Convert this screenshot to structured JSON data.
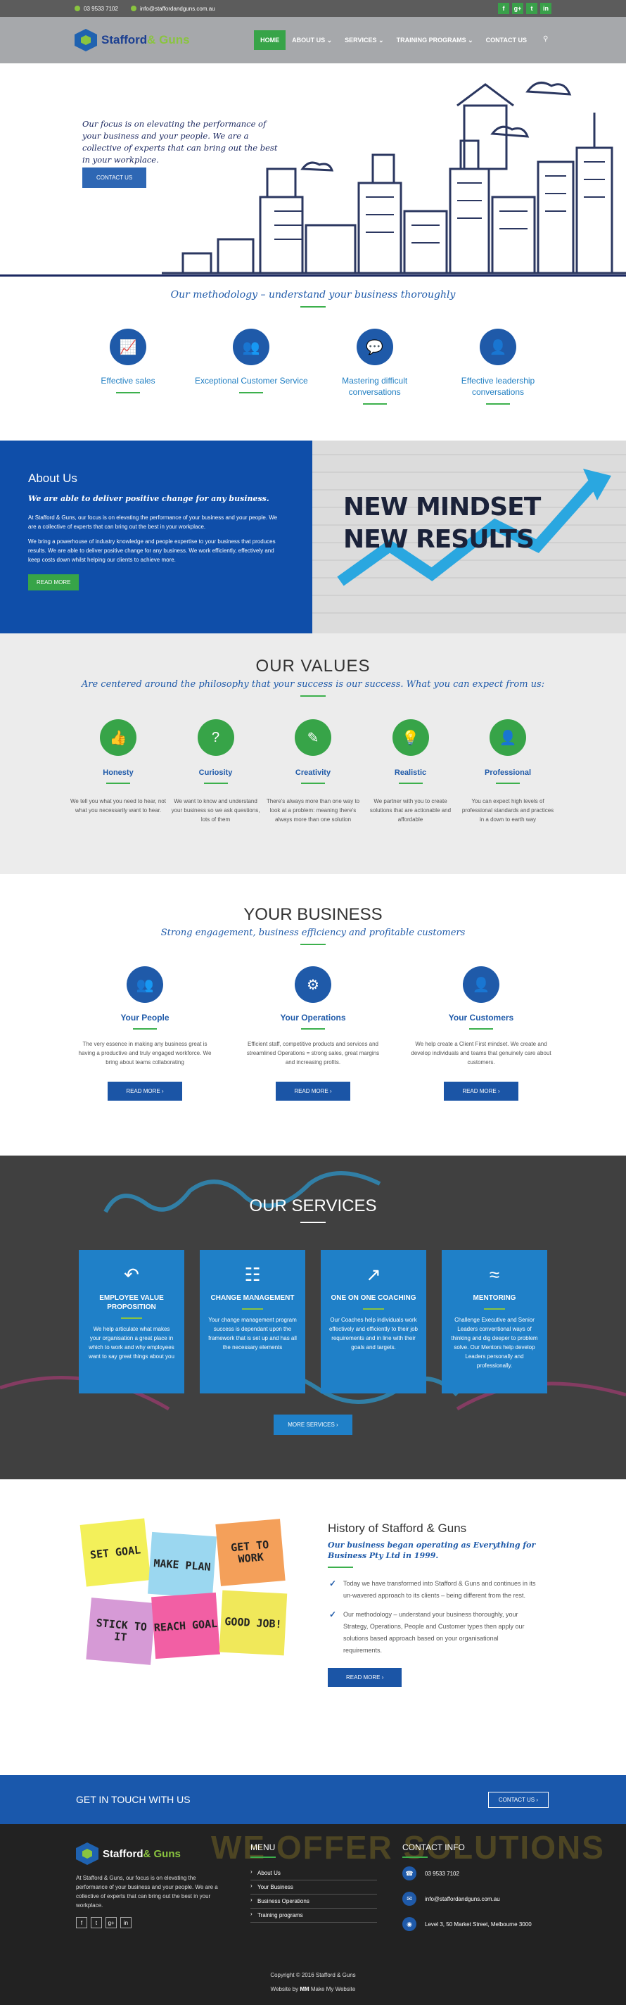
{
  "topbar": {
    "phone": "03 9533 7102",
    "email": "info@staffordandguns.com.au",
    "social": [
      "f",
      "g+",
      "t",
      "in"
    ]
  },
  "logo": {
    "name_a": "Stafford",
    "name_b": "& Guns"
  },
  "nav": {
    "items": [
      "HOME",
      "ABOUT US",
      "SERVICES",
      "TRAINING PROGRAMS",
      "CONTACT US"
    ]
  },
  "hero": {
    "text": "Our focus is on elevating the performance of your business and your people. We are a collective of experts that can bring out the best in your workplace.",
    "button": "CONTACT US"
  },
  "method": {
    "title": "Our methodology – understand your business thoroughly",
    "items": [
      "Effective sales",
      "Exceptional Customer Service",
      "Mastering difficult conversations",
      "Effective leadership conversations"
    ]
  },
  "about": {
    "title": "About Us",
    "subtitle": "We are able to deliver positive change for any business.",
    "p1": "At Stafford & Guns, our focus is on elevating the performance of your business and your people. We are a collective of experts that can bring out the best in your workplace.",
    "p2": "We bring a powerhouse of industry knowledge and people expertise to your business that produces results. We are able to deliver positive change for any business. We work efficiently, effectively and keep costs down whilst helping our clients to achieve more.",
    "button": "READ MORE",
    "img_line1": "NEW MINDSET",
    "img_line2": "NEW RESULTS"
  },
  "values": {
    "title": "OUR VALUES",
    "subtitle": "Are centered around the philosophy that your success is our success. What you can expect from us:",
    "items": [
      {
        "name": "Honesty",
        "text": "We tell you what you need to hear, not what you necessarily want to hear.",
        "icon": "thumbs-up"
      },
      {
        "name": "Curiosity",
        "text": "We want to know and understand your business so we ask questions, lots of them",
        "icon": "question"
      },
      {
        "name": "Creativity",
        "text": "There's always more than one way to look at a problem: meaning there's always more than one solution",
        "icon": "pencil"
      },
      {
        "name": "Realistic",
        "text": "We partner with you to create solutions that are actionable and affordable",
        "icon": "lightbulb"
      },
      {
        "name": "Professional",
        "text": "You can expect high levels of professional standards and practices in a down to earth way",
        "icon": "user"
      }
    ]
  },
  "business": {
    "title": "YOUR BUSINESS",
    "subtitle": "Strong engagement, business efficiency and profitable customers",
    "items": [
      {
        "name": "Your People",
        "text": "The very essence in making any business great is having a productive and truly engaged workforce. We bring about teams collaborating",
        "button": "READ MORE"
      },
      {
        "name": "Your Operations",
        "text": "Efficient staff, competitive products and services and streamlined Operations = strong sales, great margins and increasing profits.",
        "button": "READ MORE"
      },
      {
        "name": "Your Customers",
        "text": "We help create a Client First mindset. We create and develop individuals and teams that genuinely care about customers.",
        "button": "READ MORE"
      }
    ]
  },
  "services": {
    "title": "OUR SERVICES",
    "button": "MORE SERVICES",
    "items": [
      {
        "name": "EMPLOYEE VALUE PROPOSITION",
        "text": "We help articulate what makes your organisation a great place in which to work and why employees want to say great things about you"
      },
      {
        "name": "CHANGE MANAGEMENT",
        "text": "Your change management program success is dependant upon the framework that is set up and has all the necessary elements"
      },
      {
        "name": "ONE ON ONE COACHING",
        "text": "Our Coaches help individuals work effectively and efficiently to their job requirements and in line with their goals and targets."
      },
      {
        "name": "MENTORING",
        "text": "Challenge Executive and Senior Leaders conventional ways of thinking and dig deeper to problem solve. Our Mentors help develop Leaders personally and professionally."
      }
    ]
  },
  "history": {
    "title": "History of Stafford & Guns",
    "subtitle": "Our business began operating as Everything for Business Pty Ltd in 1999.",
    "points": [
      "Today we have transformed into Stafford & Guns and continues in its un-wavered approach to its clients – being different from the rest.",
      "Our methodology – understand your business thoroughly, your Strategy, Operations, People and Customer types then apply our solutions based approach based on your organisational requirements."
    ],
    "button": "READ MORE",
    "notes": [
      "SET GOAL",
      "MAKE PLAN",
      "GET TO WORK",
      "STICK TO IT",
      "REACH GOAL",
      "GOOD JOB!"
    ]
  },
  "touch": {
    "title": "GET IN TOUCH WITH US",
    "button": "CONTACT US"
  },
  "footer": {
    "watermark": "WE OFFER SOLUTIONS",
    "about": "At Stafford & Guns, our focus is on elevating the performance of your business and your people. We are a collective of experts that can bring out the best in your workplace.",
    "social": [
      "f",
      "t",
      "g+",
      "in"
    ],
    "menu_title": "MENU",
    "menu": [
      "About Us",
      "Your Business",
      "Business Operations",
      "Training programs"
    ],
    "contact_title": "CONTACT INFO",
    "phone": "03 9533 7102",
    "email": "info@staffordandguns.com.au",
    "address": "Level 3, 50 Market Street, Melbourne 3000",
    "copyright": "Copyright © 2016 Stafford & Guns",
    "credit_prefix": "Website by",
    "credit": "Make My Website"
  },
  "colors": {
    "brand_blue": "#1f5aa9",
    "brand_green": "#37a448",
    "dark": "#222222"
  }
}
